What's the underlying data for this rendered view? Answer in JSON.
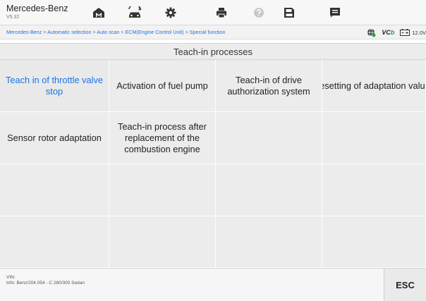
{
  "header": {
    "brand": "Mercedes-Benz",
    "version": "V5.32",
    "toolbar": [
      {
        "icon": "home-icon"
      },
      {
        "icon": "car-icon"
      },
      {
        "icon": "gear-icon"
      },
      {
        "icon": "printer-icon"
      },
      {
        "icon": "help-icon"
      },
      {
        "icon": "save-icon"
      },
      {
        "icon": "message-icon"
      }
    ]
  },
  "breadcrumb": {
    "items": [
      "Mercedes-Benz",
      "Automatic selection",
      "Auto scan",
      "ECM(Engine Control Unit)",
      "Special function"
    ],
    "separator": ">"
  },
  "status": {
    "vci_prefix": "VC",
    "vci_suffix": "b",
    "voltage": "12.0V"
  },
  "section_title": "Teach-in processes",
  "functions": [
    {
      "label": "Teach in of throttle valve stop",
      "selected": true
    },
    {
      "label": "Activation of fuel pump",
      "selected": false
    },
    {
      "label": "Teach-in of drive authorization system",
      "selected": false
    },
    {
      "label": "Resetting of adaptation values",
      "selected": false
    },
    {
      "label": "Sensor rotor adaptation",
      "selected": false
    },
    {
      "label": "Teach-in process after replacement of the combustion engine",
      "selected": false
    },
    {
      "label": "",
      "selected": false
    },
    {
      "label": "",
      "selected": false
    },
    {
      "label": "",
      "selected": false
    },
    {
      "label": "",
      "selected": false
    },
    {
      "label": "",
      "selected": false
    },
    {
      "label": "",
      "selected": false
    },
    {
      "label": "",
      "selected": false
    },
    {
      "label": "",
      "selected": false
    },
    {
      "label": "",
      "selected": false
    },
    {
      "label": "",
      "selected": false
    }
  ],
  "footer": {
    "vin_label": "VIN:",
    "info": "Info: Benz/204.054 - C 280/300 Sedan",
    "esc_label": "ESC"
  },
  "colors": {
    "accent": "#1a73e8",
    "vci_green": "#2ca343"
  }
}
